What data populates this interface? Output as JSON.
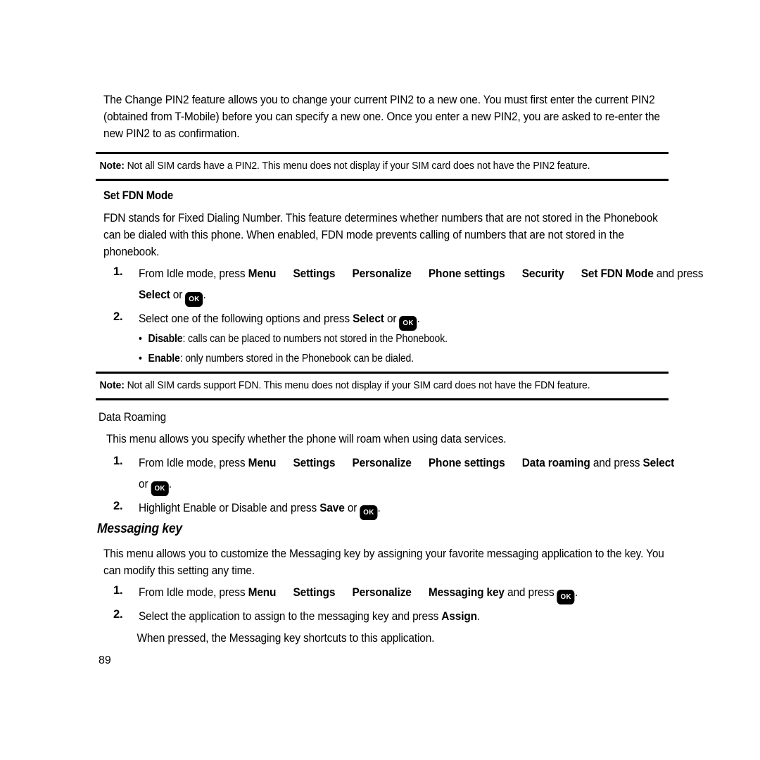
{
  "document": {
    "page_number": "89",
    "intro_paragraph": "The Change PIN2 feature allows you to change your current PIN2 to a new one. You must first enter the current PIN2 (obtained from T-Mobile) before you can specify a new one. Once you enter a new PIN2, you are asked to re-enter the new PIN2 to as confirmation.",
    "note_1": {
      "label": "Note:",
      "text": "Not all SIM cards have a PIN2. This menu does not display if your SIM card does not have the PIN2 feature."
    },
    "note_2": {
      "label": "Note:",
      "text": "Not all SIM cards support FDN. This menu does not display if your SIM card does not have the FDN feature."
    },
    "section_fdn": {
      "heading": "Set FDN Mode",
      "paragraph": "FDN stands for Fixed Dialing Number. This feature determines whether numbers that are not stored in the Phonebook can be dialed with this phone. When enabled, FDN mode prevents calling of numbers that are not stored in the phonebook.",
      "step1": {
        "number": "1.",
        "lead": "From Idle mode, press ",
        "nav": [
          "Menu",
          "Settings",
          "Personalize",
          "Phone settings",
          "Security",
          "Set FDN Mode"
        ],
        "tail": " and press ",
        "select_label": "Select",
        "or_text": " or ",
        "key": "OK",
        "period": "."
      },
      "step2": {
        "number": "2.",
        "lead": "Select one of the following options and press ",
        "select_label": "Select",
        "or_text": " or ",
        "key": "OK",
        "period": "."
      },
      "options": [
        {
          "term": "Disable",
          "desc": ": calls can be placed to numbers not stored in the Phonebook."
        },
        {
          "term": "Enable",
          "desc": ": only numbers stored in the Phonebook can be dialed."
        }
      ]
    },
    "section_roaming": {
      "heading": "Data Roaming",
      "paragraph": "This menu allows you specify whether the phone will roam when using data services.",
      "step1": {
        "number": "1.",
        "lead": "From Idle mode, press ",
        "nav": [
          "Menu",
          "Settings",
          "Personalize",
          "Phone settings",
          "Data roaming"
        ],
        "tail": " and press ",
        "select_label": "Select",
        "or_text": "or ",
        "key": "OK",
        "period": "."
      },
      "step2": {
        "number": "2.",
        "lead": "Highlight Enable or Disable and press ",
        "save_label": "Save",
        "or_text": " or ",
        "key": "OK",
        "period": "."
      }
    },
    "section_messaging": {
      "heading": "Messaging key",
      "paragraph": "This menu allows you to customize the Messaging key by assigning your favorite messaging application to the key. You can modify this setting any time.",
      "step1": {
        "number": "1.",
        "lead": "From Idle mode, press ",
        "nav": [
          "Menu",
          "Settings",
          "Personalize",
          "Messaging key"
        ],
        "tail": " and press ",
        "key": "OK",
        "period": "."
      },
      "step2": {
        "number": "2.",
        "lead": "Select the application to assign to the messaging key and press ",
        "assign_label": "Assign",
        "period": "."
      },
      "step2_note": "When pressed, the Messaging key shortcuts to this application."
    }
  }
}
